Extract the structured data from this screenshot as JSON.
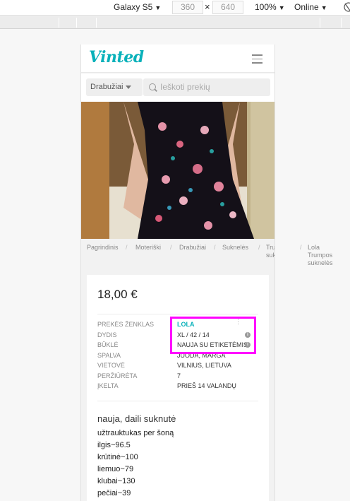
{
  "devtools": {
    "device": "Galaxy S5",
    "width": "360",
    "height": "640",
    "zoom": "100%",
    "network": "Online",
    "times": "×"
  },
  "header": {
    "logo": "Vinted"
  },
  "search": {
    "category": "Drabužiai",
    "placeholder": "Ieškoti prekių"
  },
  "breadcrumbs": [
    {
      "label": "Pagrindinis"
    },
    {
      "label": "Moteriški"
    },
    {
      "label": "Drabužiai"
    },
    {
      "label": "Suknelės"
    },
    {
      "label": "Trumpos suknelės",
      "l1": "Trumpos",
      "l2": "suknelės"
    },
    {
      "label": "Lola Trumpos suknelės",
      "l1": "Lola",
      "l2": "Trumpos",
      "l3": "suknelės"
    }
  ],
  "product": {
    "price": "18,00 €",
    "details": [
      {
        "label": "PREKĖS ŽENKLAS",
        "value": "LOLA"
      },
      {
        "label": "DYDIS",
        "value": "XL / 42 / 14"
      },
      {
        "label": "BŪKLĖ",
        "value": "NAUJA SU ETIKETĖMIS"
      },
      {
        "label": "SPALVA",
        "value": "JUODA, MARGA"
      },
      {
        "label": "VIETOVĖ",
        "value": "VILNIUS, LIETUVA"
      },
      {
        "label": "PERŽIŪRĖTA",
        "value": "7"
      },
      {
        "label": "ĮKELTA",
        "value": "PRIEŠ 14 VALANDŲ"
      }
    ],
    "title": "nauja, daili suknutė",
    "description_lines": [
      "užtrauktukas per šoną",
      "ilgis~96.5",
      "krūtinė~100",
      "liemuo~79",
      "klubai~130",
      "pečiai~39"
    ]
  },
  "colors": {
    "accent": "#09b1ba",
    "highlight": "#ff00ff"
  },
  "icons": [
    "dropdown-arrow-icon",
    "hamburger-menu-icon",
    "search-icon",
    "info-icon",
    "more-options-icon",
    "no-throttling-icon"
  ]
}
